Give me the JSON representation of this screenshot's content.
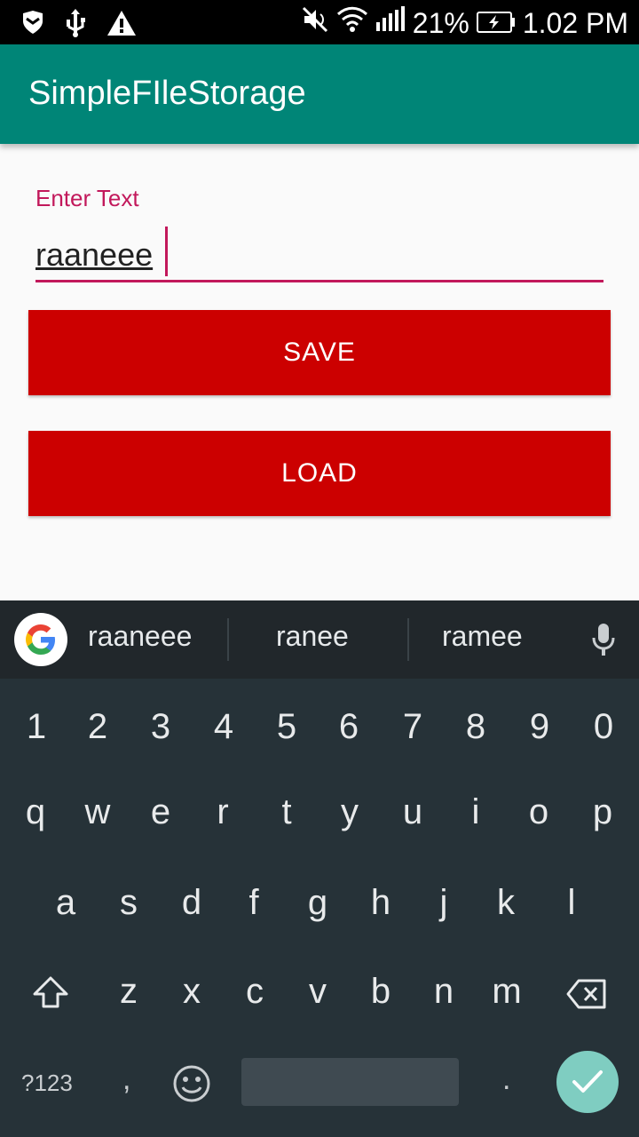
{
  "status_bar": {
    "battery_percent": "21%",
    "time": "1.02 PM",
    "icons": [
      "shield-icon",
      "usb-icon",
      "warning-icon",
      "mute-icon",
      "wifi-icon",
      "signal-icon",
      "battery-charging-icon"
    ]
  },
  "app_bar": {
    "title": "SimpleFIleStorage",
    "color": "#008577"
  },
  "form": {
    "label": "Enter Text",
    "value": "raaneee",
    "accent": "#c2185b"
  },
  "buttons": {
    "save": "SAVE",
    "load": "LOAD",
    "color": "#cc0000"
  },
  "keyboard": {
    "suggestions": [
      "raaneee",
      "ranee",
      "ramee"
    ],
    "rows": {
      "numbers": [
        "1",
        "2",
        "3",
        "4",
        "5",
        "6",
        "7",
        "8",
        "9",
        "0"
      ],
      "row1": [
        "q",
        "w",
        "e",
        "r",
        "t",
        "y",
        "u",
        "i",
        "o",
        "p"
      ],
      "row2": [
        "a",
        "s",
        "d",
        "f",
        "g",
        "h",
        "j",
        "k",
        "l"
      ],
      "row3": [
        "z",
        "x",
        "c",
        "v",
        "b",
        "n",
        "m"
      ]
    },
    "symbols_key": "?123",
    "comma": ",",
    "period": "."
  }
}
